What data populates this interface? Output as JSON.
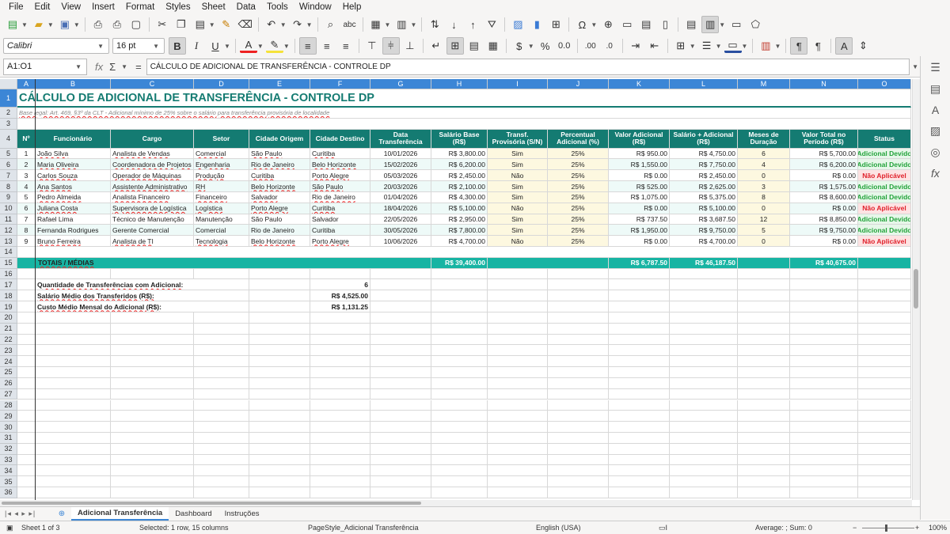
{
  "menu": [
    "File",
    "Edit",
    "View",
    "Insert",
    "Format",
    "Styles",
    "Sheet",
    "Data",
    "Tools",
    "Window",
    "Help"
  ],
  "toolbar": {
    "font_name": "Calibri",
    "font_size": "16 pt",
    "bold": "B",
    "italic": "I",
    "underline": "U"
  },
  "formula_bar": {
    "name_box": "A1:O1",
    "fx": "fx",
    "sigma": "Σ",
    "equals": "=",
    "content": "CÁLCULO DE ADICIONAL DE TRANSFERÊNCIA - CONTROLE DP"
  },
  "columns": [
    "A",
    "B",
    "C",
    "D",
    "E",
    "F",
    "G",
    "H",
    "I",
    "J",
    "K",
    "L",
    "M",
    "N",
    "O"
  ],
  "rows": [
    "1",
    "2",
    "3",
    "4",
    "5",
    "6",
    "7",
    "8",
    "9",
    "10",
    "11",
    "12",
    "13",
    "14",
    "15",
    "16",
    "17",
    "18",
    "19",
    "20",
    "21",
    "22",
    "23",
    "24",
    "25",
    "26",
    "27",
    "28",
    "29",
    "30",
    "31",
    "32",
    "33",
    "34",
    "35",
    "36"
  ],
  "sheet": {
    "title": "CÁLCULO DE ADICIONAL DE TRANSFERÊNCIA - CONTROLE DP",
    "subtitle": "Base legal: Art. 469, §3º da CLT - Adicional mínimo de 25% sobre o salário para transferência provisória de localidade",
    "headers": [
      "Nº",
      "Funcionário",
      "Cargo",
      "Setor",
      "Cidade Origem",
      "Cidade Destino",
      "Data Transferência",
      "Salário Base (R$)",
      "Transf. Provisória (S/N)",
      "Percentual Adicional (%)",
      "Valor Adicional (R$)",
      "Salário + Adicional (R$)",
      "Meses de Duração",
      "Valor Total no Período (R$)",
      "Status"
    ],
    "data": [
      [
        "1",
        "João Silva",
        "Analista de Vendas",
        "Comercial",
        "São Paulo",
        "Curitiba",
        "10/01/2026",
        "R$ 3,800.00",
        "Sim",
        "25%",
        "R$ 950.00",
        "R$ 4,750.00",
        "6",
        "R$ 5,700.00",
        "Adicional Devido"
      ],
      [
        "2",
        "Maria Oliveira",
        "Coordenadora de Projetos",
        "Engenharia",
        "Rio de Janeiro",
        "Belo Horizonte",
        "15/02/2026",
        "R$ 6,200.00",
        "Sim",
        "25%",
        "R$ 1,550.00",
        "R$ 7,750.00",
        "4",
        "R$ 6,200.00",
        "Adicional Devido"
      ],
      [
        "3",
        "Carlos Souza",
        "Operador de Máquinas",
        "Produção",
        "Curitiba",
        "Porto Alegre",
        "05/03/2026",
        "R$ 2,450.00",
        "Não",
        "25%",
        "R$ 0.00",
        "R$ 2,450.00",
        "0",
        "R$ 0.00",
        "Não Aplicável"
      ],
      [
        "4",
        "Ana Santos",
        "Assistente Administrativo",
        "RH",
        "Belo Horizonte",
        "São Paulo",
        "20/03/2026",
        "R$ 2,100.00",
        "Sim",
        "25%",
        "R$ 525.00",
        "R$ 2,625.00",
        "3",
        "R$ 1,575.00",
        "Adicional Devido"
      ],
      [
        "5",
        "Pedro Almeida",
        "Analista Financeiro",
        "Financeiro",
        "Salvador",
        "Rio de Janeiro",
        "01/04/2026",
        "R$ 4,300.00",
        "Sim",
        "25%",
        "R$ 1,075.00",
        "R$ 5,375.00",
        "8",
        "R$ 8,600.00",
        "Adicional Devido"
      ],
      [
        "6",
        "Juliana Costa",
        "Supervisora de Logística",
        "Logística",
        "Porto Alegre",
        "Curitiba",
        "18/04/2026",
        "R$ 5,100.00",
        "Não",
        "25%",
        "R$ 0.00",
        "R$ 5,100.00",
        "0",
        "R$ 0.00",
        "Não Aplicável"
      ],
      [
        "7",
        "Rafael Lima",
        "Técnico de Manutenção",
        "Manutenção",
        "São Paulo",
        "Salvador",
        "22/05/2026",
        "R$ 2,950.00",
        "Sim",
        "25%",
        "R$ 737.50",
        "R$ 3,687.50",
        "12",
        "R$ 8,850.00",
        "Adicional Devido"
      ],
      [
        "8",
        "Fernanda Rodrigues",
        "Gerente Comercial",
        "Comercial",
        "Rio de Janeiro",
        "Curitiba",
        "30/05/2026",
        "R$ 7,800.00",
        "Sim",
        "25%",
        "R$ 1,950.00",
        "R$ 9,750.00",
        "5",
        "R$ 9,750.00",
        "Adicional Devido"
      ],
      [
        "9",
        "Bruno Ferreira",
        "Analista de TI",
        "Tecnologia",
        "Belo Horizonte",
        "Porto Alegre",
        "10/06/2026",
        "R$ 4,700.00",
        "Não",
        "25%",
        "R$ 0.00",
        "R$ 4,700.00",
        "0",
        "R$ 0.00",
        "Não Aplicável"
      ]
    ],
    "totals": {
      "label": "TOTAIS / MÉDIAS",
      "salario": "R$ 39,400.00",
      "adicional": "R$ 6,787.50",
      "salario_adic": "R$ 46,187.50",
      "total": "R$ 40,675.00"
    },
    "summary": [
      {
        "label": "Quantidade de Transferências com Adicional:",
        "value": "6"
      },
      {
        "label": "Salário Médio dos Transferidos (R$):",
        "value": "R$ 4,525.00"
      },
      {
        "label": "Custo Médio Mensal do Adicional (R$):",
        "value": "R$ 1,131.25"
      }
    ]
  },
  "tabs": [
    "Adicional Transferência",
    "Dashboard",
    "Instruções"
  ],
  "status": {
    "sheet": "Sheet 1 of 3",
    "selected": "Selected: 1 row, 15 columns",
    "pagestyle": "PageStyle_Adicional Transferência",
    "lang": "English (USA)",
    "sum": "Average: ; Sum: 0",
    "zoom": "100%"
  },
  "colors": {
    "header": "#147b72",
    "total": "#17b4a3",
    "devido": "#22a33a",
    "nao": "#e0202a",
    "sel": "#3c86d6"
  }
}
